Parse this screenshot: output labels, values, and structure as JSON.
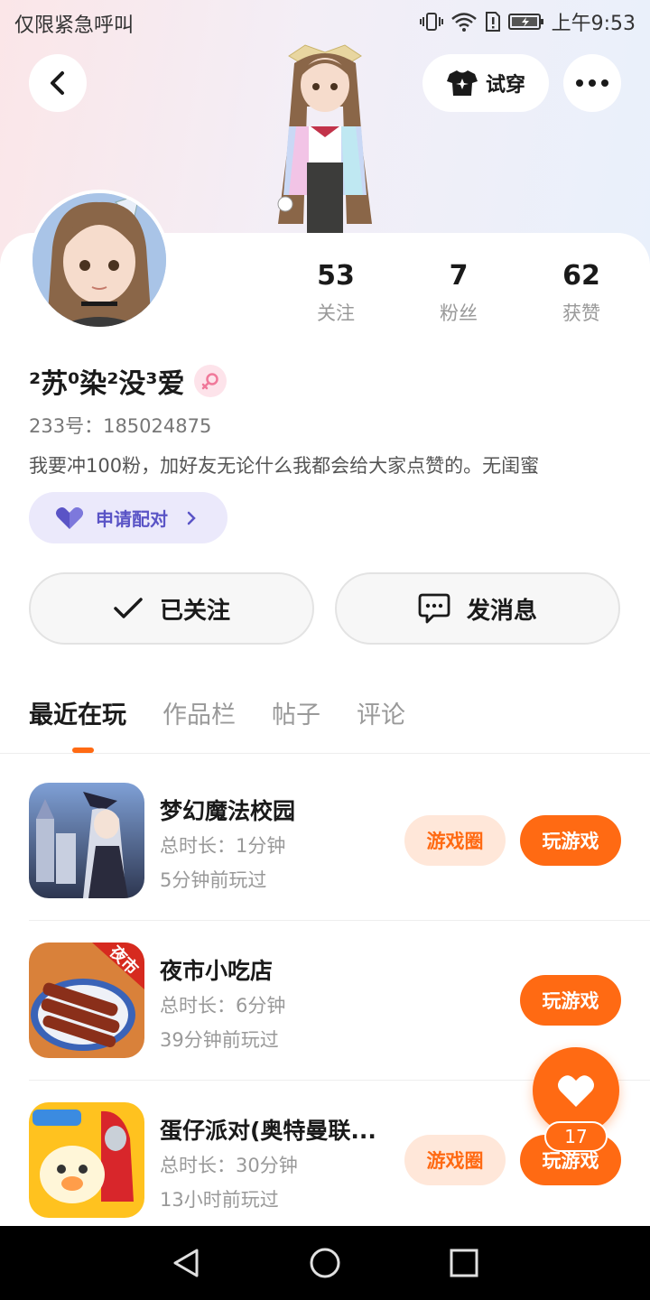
{
  "status_bar": {
    "carrier": "仅限紧急呼叫",
    "time": "上午9:53"
  },
  "header": {
    "try_on_label": "试穿"
  },
  "profile": {
    "username": "²苏⁰染²没³爱",
    "uid": "233号：185024875",
    "bio": "我要冲100粉，加好友无论什么我都会给大家点赞的。无闺蜜",
    "pair_label": "申请配对",
    "stats": [
      {
        "value": "53",
        "label": "关注"
      },
      {
        "value": "7",
        "label": "粉丝"
      },
      {
        "value": "62",
        "label": "获赞"
      }
    ],
    "follow_label": "已关注",
    "message_label": "发消息"
  },
  "tabs": [
    "最近在玩",
    "作品栏",
    "帖子",
    "评论"
  ],
  "games": [
    {
      "title": "梦幻魔法校园",
      "duration": "总时长：1分钟",
      "last_played": "5分钟前玩过",
      "circle_label": "游戏圈",
      "play_label": "玩游戏"
    },
    {
      "title": "夜市小吃店",
      "duration": "总时长：6分钟",
      "last_played": "39分钟前玩过",
      "play_label": "玩游戏",
      "badge": "夜市"
    },
    {
      "title": "蛋仔派对(奥特曼联...",
      "duration": "总时长：30分钟",
      "last_played": "13小时前玩过",
      "circle_label": "游戏圈",
      "play_label": "玩游戏"
    }
  ],
  "fab": {
    "count": "17"
  },
  "colors": {
    "accent": "#ff6a13",
    "pair": "#5a54c6",
    "tag_bg": "#ffe7d9"
  }
}
